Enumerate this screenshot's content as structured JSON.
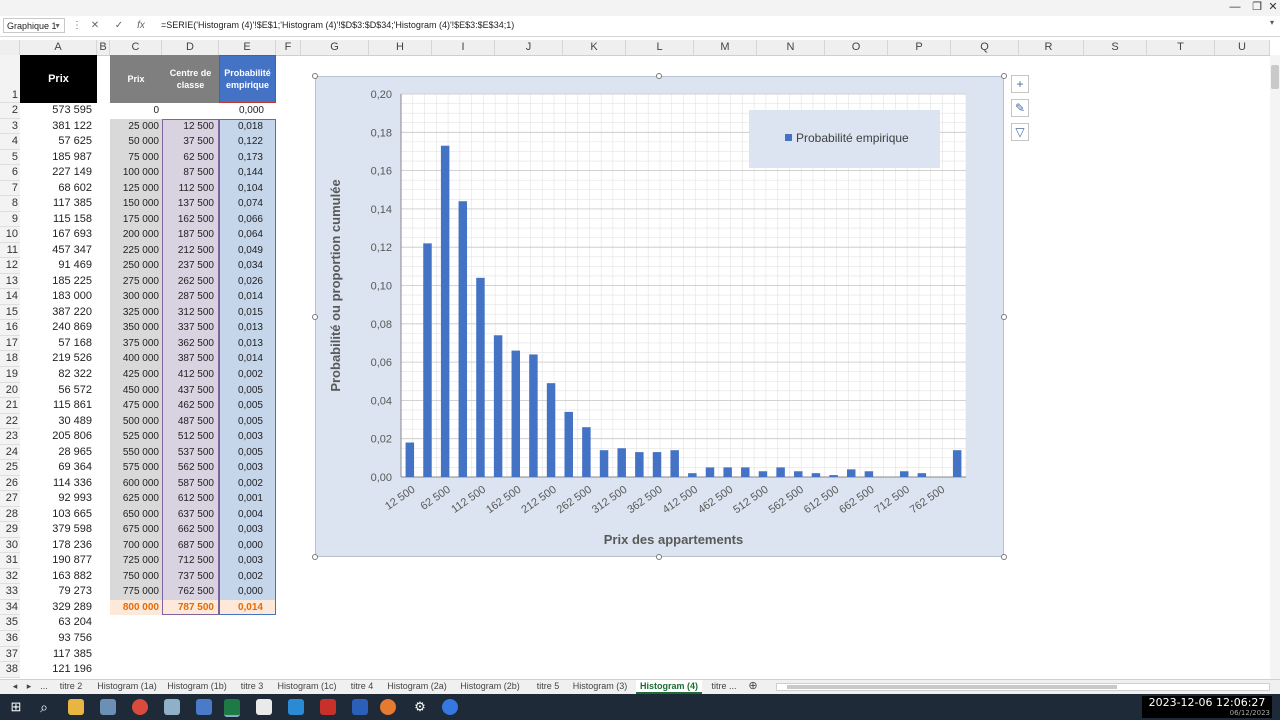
{
  "formula_bar": {
    "name_box": "Graphique 1",
    "fx": "fx",
    "formula": "=SERIE('Histogram (4)'!$E$1;'Histogram (4)'!$D$3:$D$34;'Histogram (4)'!$E$3:$E$34;1)"
  },
  "columns": [
    "A",
    "B",
    "C",
    "D",
    "E",
    "F",
    "G",
    "H",
    "I",
    "J",
    "K",
    "L",
    "M",
    "N",
    "O",
    "P",
    "Q",
    "R",
    "S",
    "T",
    "U"
  ],
  "headers": {
    "prix_a": "Prix",
    "prix_c": "Prix",
    "centre": "Centre de classe",
    "proba": "Probabilité empirique"
  },
  "rows": [
    1,
    2,
    3,
    4,
    5,
    6,
    7,
    8,
    9,
    10,
    11,
    12,
    13,
    14,
    15,
    16,
    17,
    18,
    19,
    20,
    21,
    22,
    23,
    24,
    25,
    26,
    27,
    28,
    29,
    30,
    31,
    32,
    33,
    34,
    35,
    36,
    37,
    38
  ],
  "col_a": [
    "573 595",
    "381 122",
    "57 625",
    "185 987",
    "227 149",
    "68 602",
    "117 385",
    "115 158",
    "167 693",
    "457 347",
    "91 469",
    "185 225",
    "183 000",
    "387 220",
    "240 869",
    "57 168",
    "219 526",
    "82 322",
    "56 572",
    "115 861",
    "30 489",
    "205 806",
    "28 965",
    "69 364",
    "114 336",
    "92 993",
    "103 665",
    "379 598",
    "178 236",
    "190 877",
    "163 882",
    "79 273",
    "329 289",
    "63 204",
    "93 756",
    "117 385",
    "121 196"
  ],
  "col_c": [
    "0",
    "25 000",
    "50 000",
    "75 000",
    "100 000",
    "125 000",
    "150 000",
    "175 000",
    "200 000",
    "225 000",
    "250 000",
    "275 000",
    "300 000",
    "325 000",
    "350 000",
    "375 000",
    "400 000",
    "425 000",
    "450 000",
    "475 000",
    "500 000",
    "525 000",
    "550 000",
    "575 000",
    "600 000",
    "625 000",
    "650 000",
    "675 000",
    "700 000",
    "725 000",
    "750 000",
    "775 000",
    "800 000"
  ],
  "col_d": [
    "",
    "12 500",
    "37 500",
    "62 500",
    "87 500",
    "112 500",
    "137 500",
    "162 500",
    "187 500",
    "212 500",
    "237 500",
    "262 500",
    "287 500",
    "312 500",
    "337 500",
    "362 500",
    "387 500",
    "412 500",
    "437 500",
    "462 500",
    "487 500",
    "512 500",
    "537 500",
    "562 500",
    "587 500",
    "612 500",
    "637 500",
    "662 500",
    "687 500",
    "712 500",
    "737 500",
    "762 500",
    "787 500"
  ],
  "col_e": [
    "0,000",
    "0,018",
    "0,122",
    "0,173",
    "0,144",
    "0,104",
    "0,074",
    "0,066",
    "0,064",
    "0,049",
    "0,034",
    "0,026",
    "0,014",
    "0,015",
    "0,013",
    "0,013",
    "0,014",
    "0,002",
    "0,005",
    "0,005",
    "0,005",
    "0,003",
    "0,005",
    "0,003",
    "0,002",
    "0,001",
    "0,004",
    "0,003",
    "0,000",
    "0,003",
    "0,002",
    "0,000",
    "0,014"
  ],
  "chart_data": {
    "type": "bar",
    "categories": [
      "12 500",
      "37 500",
      "62 500",
      "87 500",
      "112 500",
      "137 500",
      "162 500",
      "187 500",
      "212 500",
      "237 500",
      "262 500",
      "287 500",
      "312 500",
      "337 500",
      "362 500",
      "387 500",
      "412 500",
      "437 500",
      "462 500",
      "487 500",
      "512 500",
      "537 500",
      "562 500",
      "587 500",
      "612 500",
      "637 500",
      "662 500",
      "687 500",
      "712 500",
      "737 500",
      "762 500",
      "787 500"
    ],
    "series": [
      {
        "name": "Probabilité empirique",
        "values": [
          0.018,
          0.122,
          0.173,
          0.144,
          0.104,
          0.074,
          0.066,
          0.064,
          0.049,
          0.034,
          0.026,
          0.014,
          0.015,
          0.013,
          0.013,
          0.014,
          0.002,
          0.005,
          0.005,
          0.005,
          0.003,
          0.005,
          0.003,
          0.002,
          0.001,
          0.004,
          0.003,
          0.0,
          0.003,
          0.002,
          0.0,
          0.014
        ]
      }
    ],
    "xlabel": "Prix des appartements",
    "ylabel": "Probabilité  ou proportion cumulée",
    "ylim": [
      0,
      0.2
    ],
    "yticks": [
      "0,00",
      "0,02",
      "0,04",
      "0,06",
      "0,08",
      "0,10",
      "0,12",
      "0,14",
      "0,16",
      "0,18",
      "0,20"
    ],
    "xtick_labels": [
      "12 500",
      "62 500",
      "112 500",
      "162 500",
      "212 500",
      "262 500",
      "312 500",
      "362 500",
      "412 500",
      "462 500",
      "512 500",
      "562 500",
      "612 500",
      "662 500",
      "712 500",
      "762 500"
    ],
    "legend": "top-right",
    "grid": true,
    "bar_color": "#4472c4"
  },
  "sheet_tabs": [
    "...",
    "titre 2",
    "Histogram (1a)",
    "Histogram (1b)",
    "titre 3",
    "Histogram (1c)",
    "titre 4",
    "Histogram (2a)",
    "Histogram (2b)",
    "titre 5",
    "Histogram (3)",
    "Histogram (4)",
    "titre ..."
  ],
  "active_tab": "Histogram (4)",
  "clock": {
    "time": "2023-12-06  12:06:27",
    "date": "06/12/2023"
  }
}
